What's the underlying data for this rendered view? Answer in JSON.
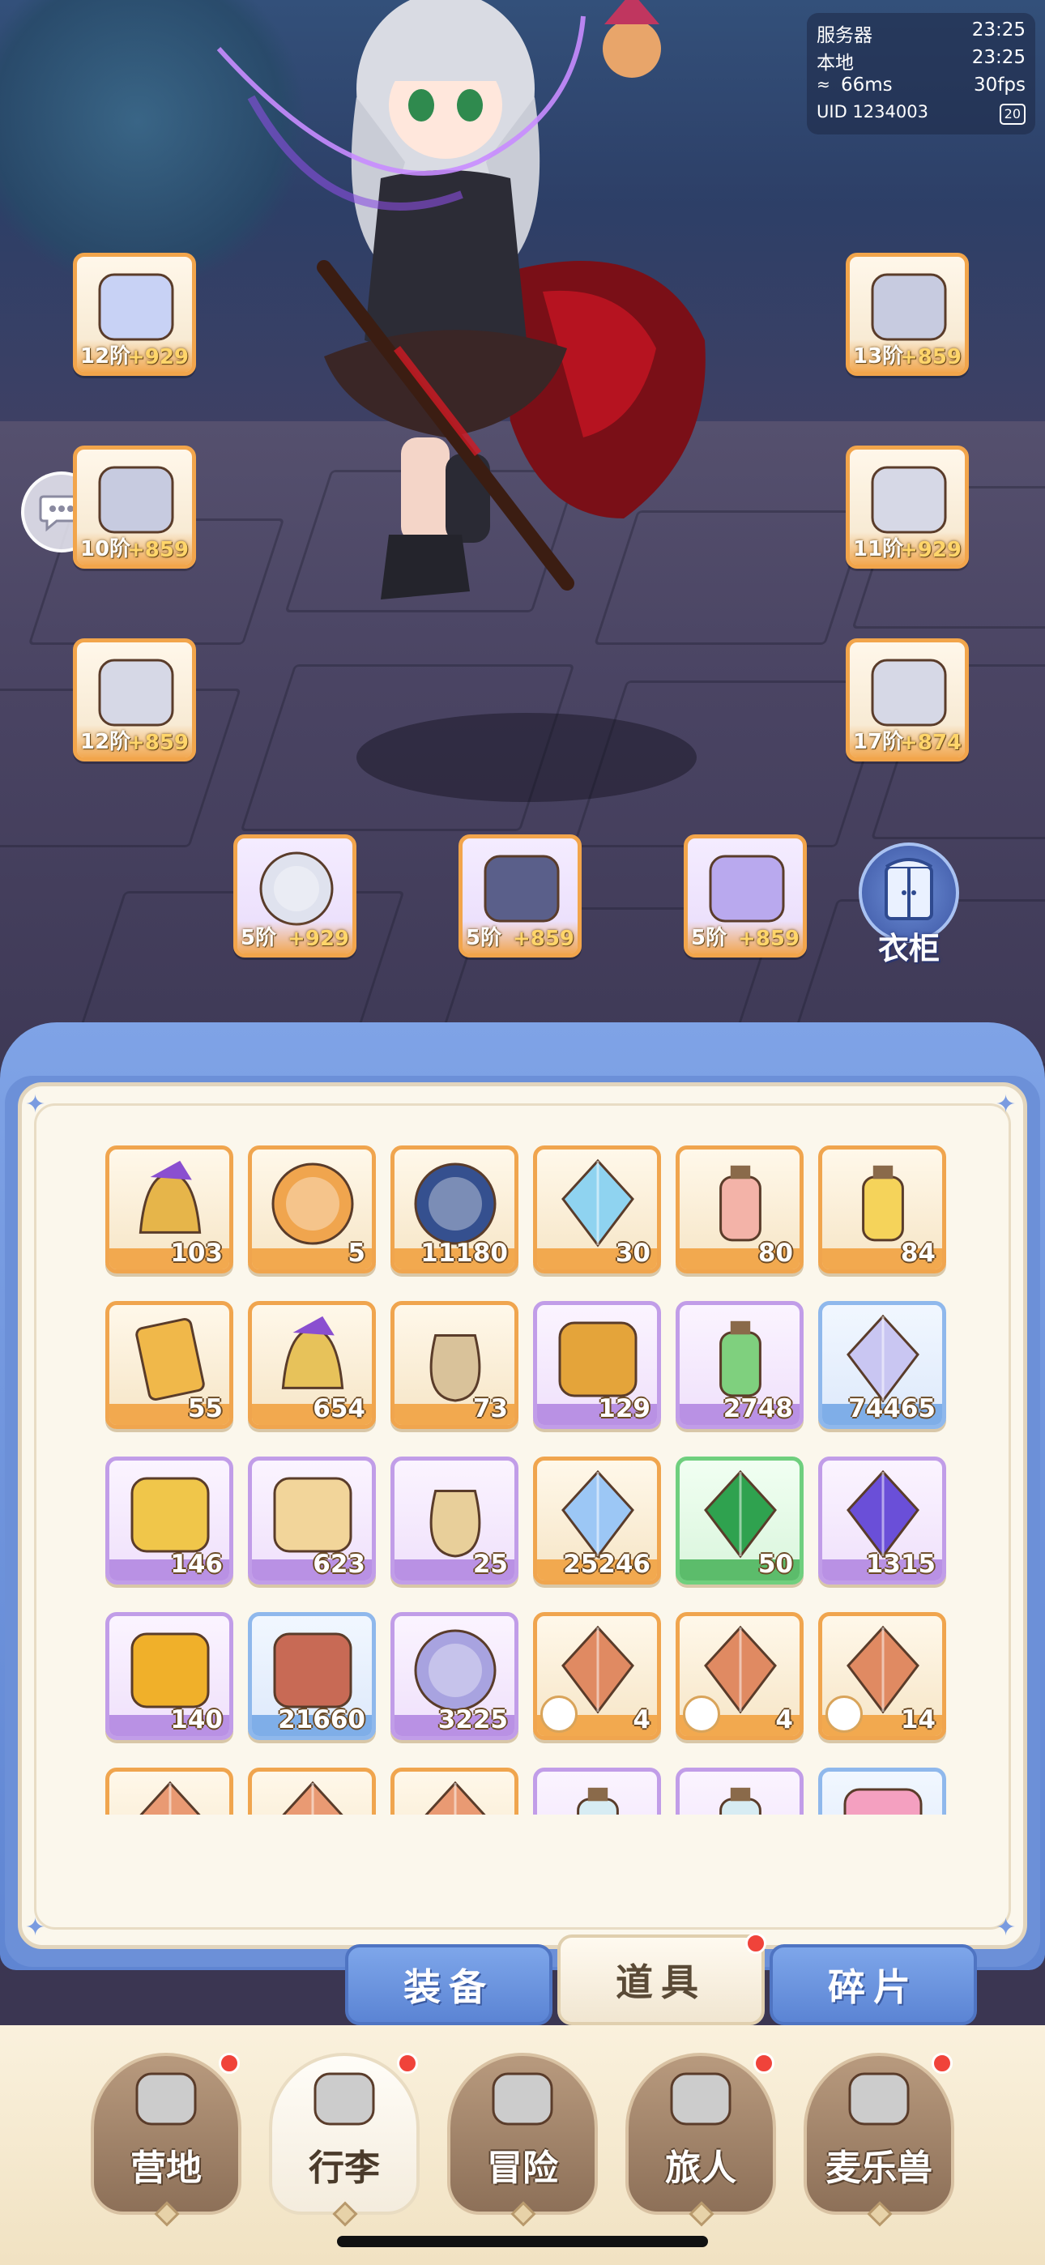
{
  "status": {
    "server_label": "服务器",
    "server_time": "23:25",
    "local_label": "本地",
    "local_time": "23:25",
    "ping": "66ms",
    "fps": "30fps",
    "uid": "UID 1234003",
    "battery": "20"
  },
  "equipment": [
    {
      "level": "12阶",
      "bonus": "+929",
      "icon": "bow-icon"
    },
    {
      "level": "13阶",
      "bonus": "+859",
      "icon": "helmet-icon"
    },
    {
      "level": "10阶",
      "bonus": "+859",
      "icon": "shoulder-armor-icon"
    },
    {
      "level": "11阶",
      "bonus": "+929",
      "icon": "gauntlet-icon"
    },
    {
      "level": "12阶",
      "bonus": "+859",
      "icon": "chest-armor-icon"
    },
    {
      "level": "17阶",
      "bonus": "+874",
      "icon": "boots-icon"
    },
    {
      "level": "5阶",
      "bonus": "+929",
      "icon": "ring-icon"
    },
    {
      "level": "5阶",
      "bonus": "+859",
      "icon": "necklace-icon"
    },
    {
      "level": "5阶",
      "bonus": "+859",
      "icon": "amulet-icon"
    }
  ],
  "wardrobe_label": "衣柜",
  "items": [
    {
      "count": "103",
      "rarity": "orange",
      "icon": "bell-icon"
    },
    {
      "count": "5",
      "rarity": "orange",
      "icon": "cat-coin-icon"
    },
    {
      "count": "11180",
      "rarity": "orange",
      "icon": "rune-orb-icon"
    },
    {
      "count": "30",
      "rarity": "orange",
      "icon": "ice-crystal-icon"
    },
    {
      "count": "80",
      "rarity": "orange",
      "icon": "paint-tube-icon"
    },
    {
      "count": "84",
      "rarity": "orange",
      "icon": "paint-splash-icon"
    },
    {
      "count": "55",
      "rarity": "orange",
      "icon": "card-icon"
    },
    {
      "count": "654",
      "rarity": "orange",
      "icon": "jingle-bell-icon"
    },
    {
      "count": "73",
      "rarity": "orange",
      "icon": "seed-sack-icon"
    },
    {
      "count": "129",
      "rarity": "purple",
      "icon": "horseshoe-icon"
    },
    {
      "count": "2748",
      "rarity": "purple",
      "icon": "potion-bottle-icon"
    },
    {
      "count": "74465",
      "rarity": "blue",
      "icon": "crystal-pile-icon"
    },
    {
      "count": "146",
      "rarity": "purple",
      "icon": "paw-stamp-icon"
    },
    {
      "count": "623",
      "rarity": "purple",
      "icon": "spoon-icon"
    },
    {
      "count": "25",
      "rarity": "purple",
      "icon": "flour-sack-icon"
    },
    {
      "count": "25246",
      "rarity": "orange",
      "icon": "star-crystal-icon"
    },
    {
      "count": "50",
      "rarity": "green",
      "icon": "green-gem-icon"
    },
    {
      "count": "1315",
      "rarity": "purple",
      "icon": "purple-crystal-icon"
    },
    {
      "count": "140",
      "rarity": "purple",
      "icon": "golden-egg-icon"
    },
    {
      "count": "21660",
      "rarity": "blue",
      "icon": "leather-icon"
    },
    {
      "count": "3225",
      "rarity": "purple",
      "icon": "heart-coin-icon"
    },
    {
      "count": "4",
      "rarity": "orange",
      "icon": "ore-sword-icon",
      "badge": true
    },
    {
      "count": "4",
      "rarity": "orange",
      "icon": "ore-helmet-icon",
      "badge": true
    },
    {
      "count": "14",
      "rarity": "orange",
      "icon": "ore-armor-icon",
      "badge": true
    },
    {
      "count": "",
      "rarity": "orange",
      "icon": "ore-icon"
    },
    {
      "count": "",
      "rarity": "orange",
      "icon": "ore-icon"
    },
    {
      "count": "",
      "rarity": "orange",
      "icon": "ore-icon"
    },
    {
      "count": "",
      "rarity": "purple",
      "icon": "bottle-icon"
    },
    {
      "count": "",
      "rarity": "purple",
      "icon": "bottle-icon"
    },
    {
      "count": "",
      "rarity": "blue",
      "icon": "paw-icon"
    }
  ],
  "tabs": [
    {
      "label": "装备",
      "active": false
    },
    {
      "label": "道具",
      "active": true,
      "dot": true
    },
    {
      "label": "碎片",
      "active": false
    }
  ],
  "nav": [
    {
      "label": "营地",
      "icon": "castle-icon",
      "dot": true,
      "active": false
    },
    {
      "label": "行李",
      "icon": "backpack-icon",
      "dot": true,
      "active": true
    },
    {
      "label": "冒险",
      "icon": "crossed-swords-icon",
      "dot": false,
      "active": false
    },
    {
      "label": "旅人",
      "icon": "traveler-icon",
      "dot": true,
      "active": false
    },
    {
      "label": "麦乐兽",
      "icon": "cat-pet-icon",
      "dot": true,
      "active": false
    }
  ],
  "colors": {
    "orange": "#f0a54e",
    "purple": "#c19de8",
    "blue": "#8fb8ec",
    "green": "#6fcf7e",
    "tab_blue": "#5b84d4",
    "badge_red": "#f0433a"
  }
}
